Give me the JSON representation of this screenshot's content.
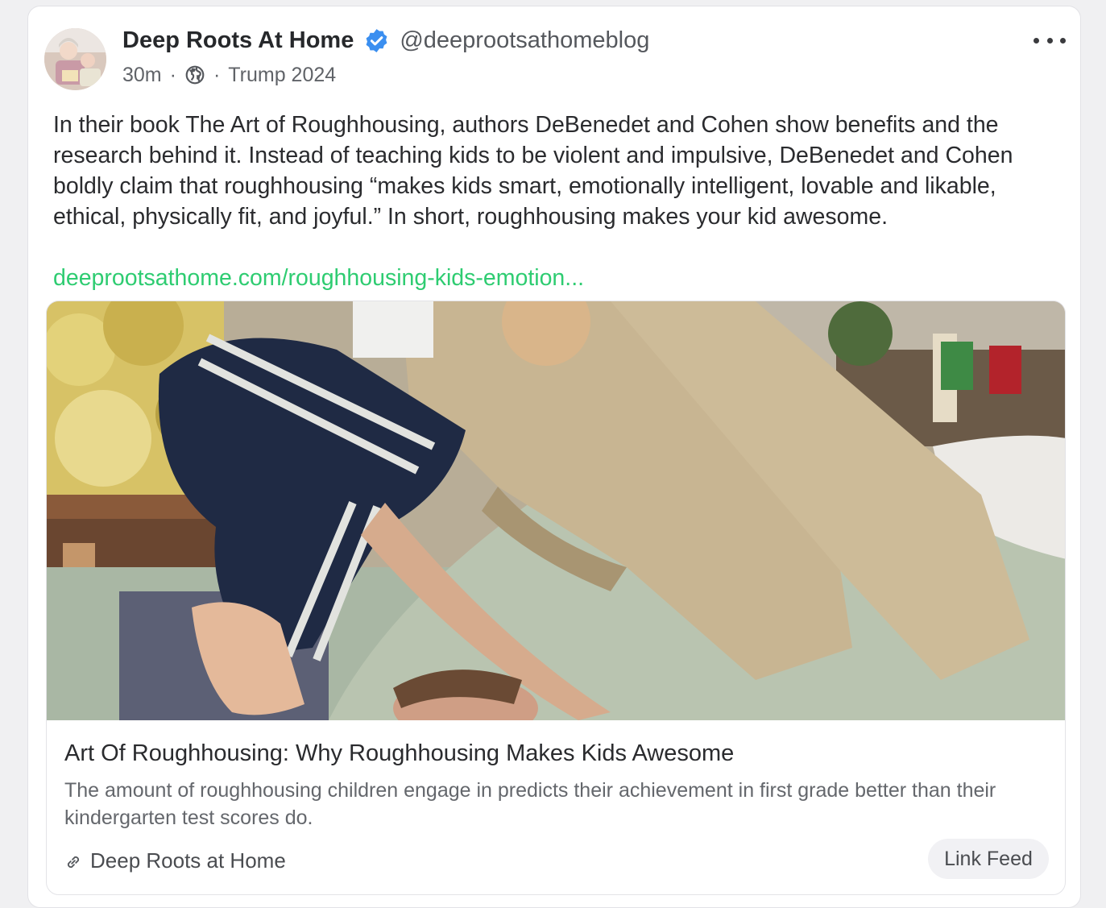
{
  "post": {
    "author_name": "Deep Roots At Home",
    "handle": "@deeprootsathomeblog",
    "time": "30m",
    "separator": "·",
    "tag": "Trump 2024",
    "body": "In their book The Art of Roughhousing, authors DeBenedet and Cohen show benefits and the research behind it. Instead of teaching kids to be violent and impulsive, DeBenedet and Cohen boldly claim that roughhousing “makes kids smart, emotionally intelligent, lovable and likable, ethical, physically fit, and joyful.” In short, roughhousing makes your kid awesome.",
    "link_text": "deeprootsathome.com/roughhousing-kids-emotion..."
  },
  "icons": {
    "verified": "verified-badge-icon",
    "visibility": "globe-icon",
    "more": "more-options-icon",
    "link": "link-icon"
  },
  "preview": {
    "title": "Art Of Roughhousing: Why Roughhousing Makes Kids Awesome",
    "description": "The amount of roughhousing children engage in predicts their achievement in first grade better than their kindergarten test scores do.",
    "source": "Deep Roots at Home",
    "feed_button": "Link Feed"
  },
  "colors": {
    "link": "#2ecc71",
    "verified": "#3b8ff0",
    "card_background": "#ffffff",
    "page_background": "#f0f0f2"
  }
}
